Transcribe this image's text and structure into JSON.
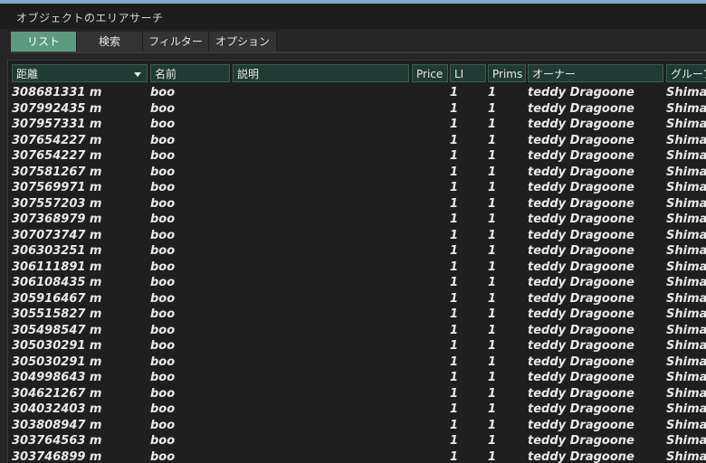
{
  "window": {
    "title": "オブジェクトのエリアサーチ"
  },
  "tabs": [
    {
      "label": "リスト",
      "active": true
    },
    {
      "label": "検索",
      "active": false
    },
    {
      "label": "フィルター",
      "active": false
    },
    {
      "label": "オプション",
      "active": false
    }
  ],
  "table": {
    "columns": [
      "距離",
      "名前",
      "説明",
      "Price",
      "LI",
      "Prims",
      "オーナー",
      "グループ"
    ],
    "rows": [
      [
        "308681331 m",
        "boo",
        "",
        "",
        "1",
        "1",
        "teddy Dragoone",
        "Shima"
      ],
      [
        "307992435 m",
        "boo",
        "",
        "",
        "1",
        "1",
        "teddy Dragoone",
        "Shima"
      ],
      [
        "307957331 m",
        "boo",
        "",
        "",
        "1",
        "1",
        "teddy Dragoone",
        "Shima"
      ],
      [
        "307654227 m",
        "boo",
        "",
        "",
        "1",
        "1",
        "teddy Dragoone",
        "Shima"
      ],
      [
        "307654227 m",
        "boo",
        "",
        "",
        "1",
        "1",
        "teddy Dragoone",
        "Shima"
      ],
      [
        "307581267 m",
        "boo",
        "",
        "",
        "1",
        "1",
        "teddy Dragoone",
        "Shima"
      ],
      [
        "307569971 m",
        "boo",
        "",
        "",
        "1",
        "1",
        "teddy Dragoone",
        "Shima"
      ],
      [
        "307557203 m",
        "boo",
        "",
        "",
        "1",
        "1",
        "teddy Dragoone",
        "Shima"
      ],
      [
        "307368979 m",
        "boo",
        "",
        "",
        "1",
        "1",
        "teddy Dragoone",
        "Shima"
      ],
      [
        "307073747 m",
        "boo",
        "",
        "",
        "1",
        "1",
        "teddy Dragoone",
        "Shima"
      ],
      [
        "306303251 m",
        "boo",
        "",
        "",
        "1",
        "1",
        "teddy Dragoone",
        "Shima"
      ],
      [
        "306111891 m",
        "boo",
        "",
        "",
        "1",
        "1",
        "teddy Dragoone",
        "Shima"
      ],
      [
        "306108435 m",
        "boo",
        "",
        "",
        "1",
        "1",
        "teddy Dragoone",
        "Shima"
      ],
      [
        "305916467 m",
        "boo",
        "",
        "",
        "1",
        "1",
        "teddy Dragoone",
        "Shima"
      ],
      [
        "305515827 m",
        "boo",
        "",
        "",
        "1",
        "1",
        "teddy Dragoone",
        "Shima"
      ],
      [
        "305498547 m",
        "boo",
        "",
        "",
        "1",
        "1",
        "teddy Dragoone",
        "Shima"
      ],
      [
        "305030291 m",
        "boo",
        "",
        "",
        "1",
        "1",
        "teddy Dragoone",
        "Shima"
      ],
      [
        "305030291 m",
        "boo",
        "",
        "",
        "1",
        "1",
        "teddy Dragoone",
        "Shima"
      ],
      [
        "304998643 m",
        "boo",
        "",
        "",
        "1",
        "1",
        "teddy Dragoone",
        "Shima"
      ],
      [
        "304621267 m",
        "boo",
        "",
        "",
        "1",
        "1",
        "teddy Dragoone",
        "Shima"
      ],
      [
        "304032403 m",
        "boo",
        "",
        "",
        "1",
        "1",
        "teddy Dragoone",
        "Shima"
      ],
      [
        "303808947 m",
        "boo",
        "",
        "",
        "1",
        "1",
        "teddy Dragoone",
        "Shima"
      ],
      [
        "303764563 m",
        "boo",
        "",
        "",
        "1",
        "1",
        "teddy Dragoone",
        "Shima"
      ],
      [
        "303746899 m",
        "boo",
        "",
        "",
        "1",
        "1",
        "teddy Dragoone",
        "Shima"
      ]
    ]
  },
  "colors": {
    "active_tab": "#5b9a7e",
    "header_bg": "#1f3b34",
    "list_bg": "#1f1f1f"
  }
}
